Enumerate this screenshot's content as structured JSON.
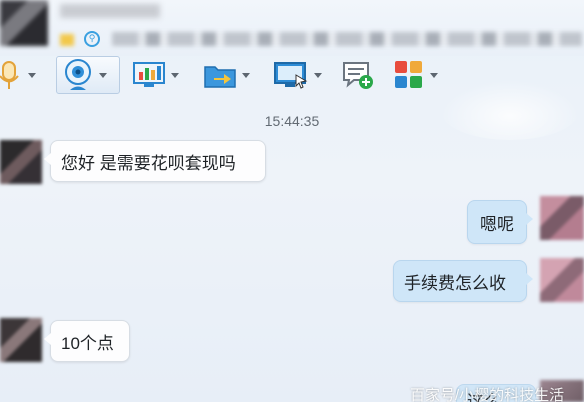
{
  "title_bar": {
    "status_badge": "⚲",
    "icons": [
      "avatar",
      "qr-code-icon"
    ]
  },
  "toolbar": {
    "items": [
      {
        "name": "voice-call-icon",
        "color": "#f0a93a"
      },
      {
        "name": "video-call-icon",
        "color": "#2a8fd6"
      },
      {
        "name": "screen-share-icon",
        "color": "#2a8fd6"
      },
      {
        "name": "file-transfer-icon",
        "color": "#2a8fd6"
      },
      {
        "name": "remote-desktop-icon",
        "color": "#2a8fd6"
      },
      {
        "name": "create-discussion-icon",
        "color": "#2aa84a"
      },
      {
        "name": "apps-icon",
        "color": "#e84c3d"
      }
    ]
  },
  "chat": {
    "timestamp": "15:44:35",
    "messages": [
      {
        "direction": "incoming",
        "text": "您好  是需要花呗套现吗"
      },
      {
        "direction": "outgoing",
        "text": "嗯呢"
      },
      {
        "direction": "outgoing",
        "text": "手续费怎么收"
      },
      {
        "direction": "incoming",
        "text": "10个点"
      },
      {
        "direction": "outgoing",
        "text": "这么"
      }
    ]
  },
  "watermark": "百家号/小樱的科技生活",
  "colors": {
    "incoming_bubble": "#fdfdfe",
    "outgoing_bubble": "#cfe6f8",
    "background": "#e9f1f9"
  }
}
